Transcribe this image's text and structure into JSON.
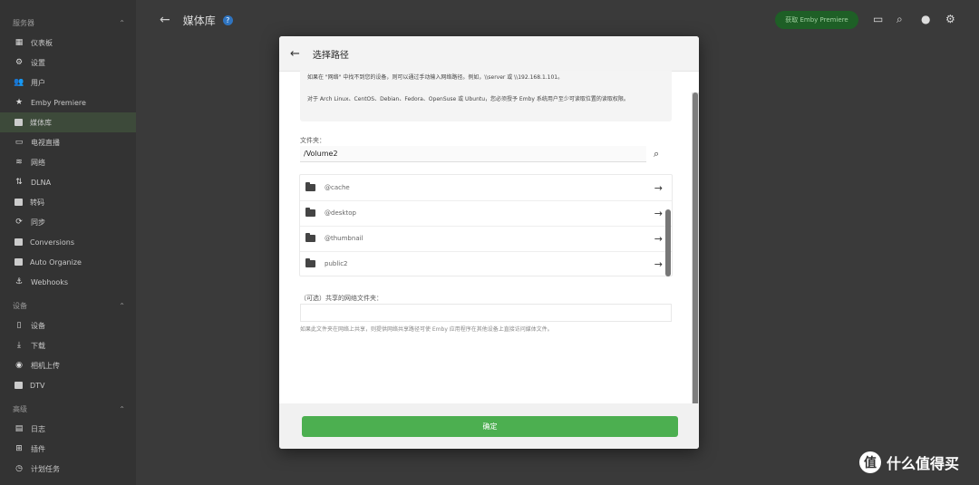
{
  "app": {
    "title": "媒体库",
    "premiere_label": "获取 Emby Premiere"
  },
  "sidebar": {
    "sections": [
      {
        "label": "服务器",
        "items": [
          "仪表板",
          "设置",
          "用户",
          "Emby Premiere",
          "媒体库",
          "电视直播",
          "网络",
          "DLNA",
          "转码",
          "同步",
          "Conversions",
          "Auto Organize",
          "Webhooks"
        ]
      },
      {
        "label": "设备",
        "items": [
          "设备",
          "下载",
          "相机上传",
          "DTV"
        ]
      },
      {
        "label": "高级",
        "items": [
          "日志",
          "插件",
          "计划任务"
        ]
      }
    ]
  },
  "dialog": {
    "title": "选择路径",
    "help_line1": "如果在 \"网络\" 中找不到您的设备，则可以通过手动输入网络路径。例如，\\\\server 或 \\\\192.168.1.101。",
    "help_line2": "对于 Arch Linux、CentOS、Debian、Fedora、OpenSuse 或 Ubuntu，您必须授予 Emby 系统用户至少可读取位置的读取权限。",
    "folder_label": "文件夹：",
    "folder_value": "/Volume2",
    "directories": [
      {
        "name": "@cache"
      },
      {
        "name": "@desktop"
      },
      {
        "name": "@thumbnail"
      },
      {
        "name": "public2"
      }
    ],
    "share_label": "（可选）共享的网络文件夹：",
    "share_help": "如果此文件夹在网络上共享，则提供网络共享路径可使 Emby 应用程序在其他设备上直接访问媒体文件。",
    "ok_label": "确定"
  },
  "watermark": {
    "badge": "值",
    "text": "什么值得买"
  }
}
